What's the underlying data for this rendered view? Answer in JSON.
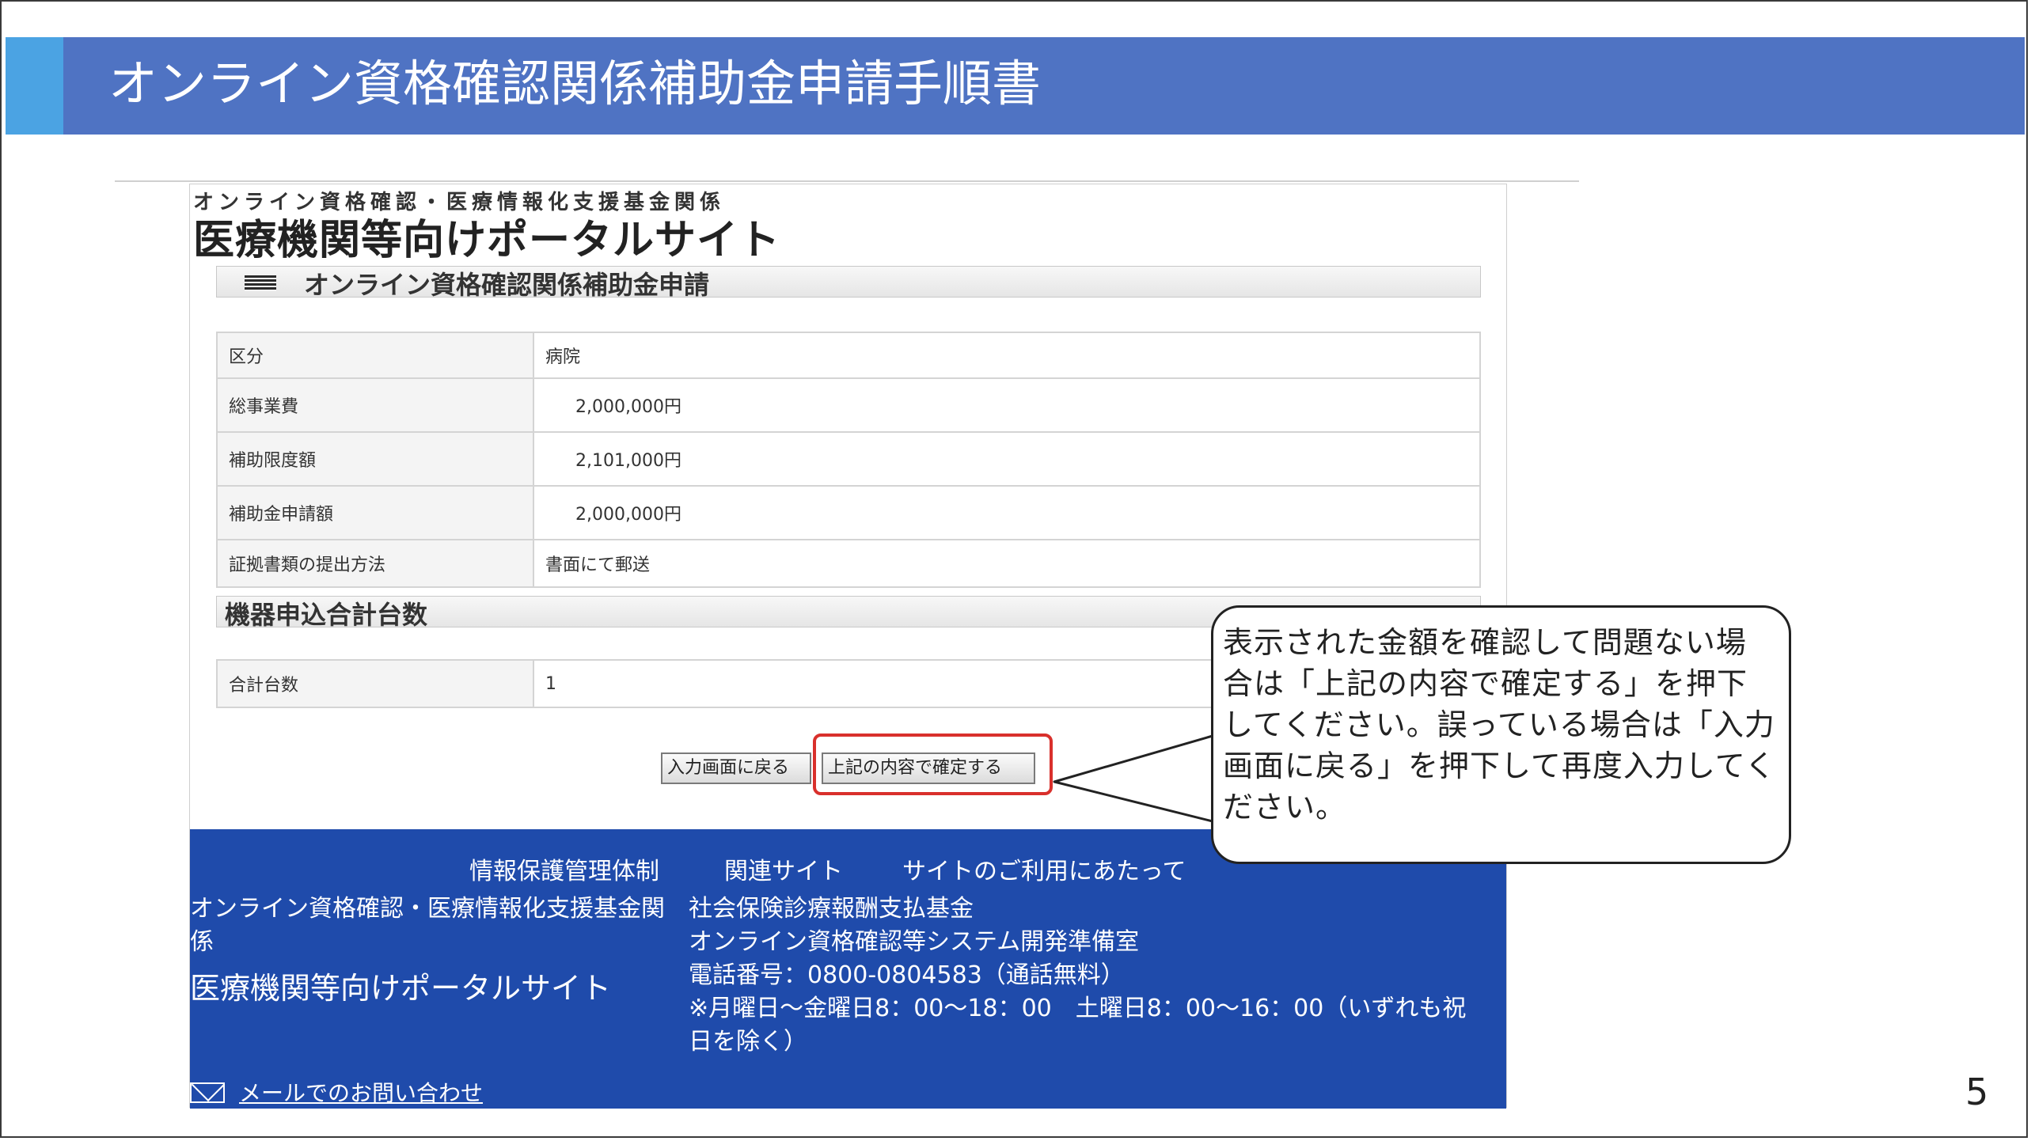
{
  "slide": {
    "title": "オンライン資格確認関係補助金申請手順書",
    "page_number": "5",
    "colors": {
      "title_bar": "#4f73c3",
      "title_accent": "#4ba3e3",
      "footer": "#1f4bab",
      "highlight": "#d9302c"
    }
  },
  "portal": {
    "subtitle": "オンライン資格確認・医療情報化支援基金関係",
    "title": "医療機関等向けポータルサイト",
    "section_title": "オンライン資格確認関係補助金申請",
    "rows": [
      {
        "label": "区分",
        "value": "病院"
      },
      {
        "label": "総事業費",
        "value": "2,000,000円"
      },
      {
        "label": "補助限度額",
        "value": "2,101,000円"
      },
      {
        "label": "補助金申請額",
        "value": "2,000,000円"
      },
      {
        "label": "証拠書類の提出方法",
        "value": "書面にて郵送"
      }
    ],
    "device_section_title": "機器申込合計台数",
    "device_rows": [
      {
        "label": "合計台数",
        "value": "1"
      }
    ],
    "buttons": {
      "back": "入力画面に戻る",
      "confirm": "上記の内容で確定する"
    },
    "footer": {
      "links": [
        "情報保護管理体制",
        "関連サイト",
        "サイトのご利用にあたって"
      ],
      "org": "オンライン資格確認・医療情報化支援基金関係",
      "portal": "医療機関等向けポータルサイト",
      "contact_org": "社会保険診療報酬支払基金",
      "contact_dept": "オンライン資格確認等システム開発準備室",
      "phone": "電話番号：0800-0804583（通話無料）",
      "hours": "※月曜日～金曜日8：00～18：00　土曜日8：00～16：00（いずれも祝日を除く）",
      "mail_link": "メールでのお問い合わせ",
      "mail_icon": "envelope-icon"
    }
  },
  "callout": {
    "text": "表示された金額を確認して問題ない場合は「上記の内容で確定する」を押下してください。誤っている場合は「入力画面に戻る」を押下して再度入力してください。"
  }
}
